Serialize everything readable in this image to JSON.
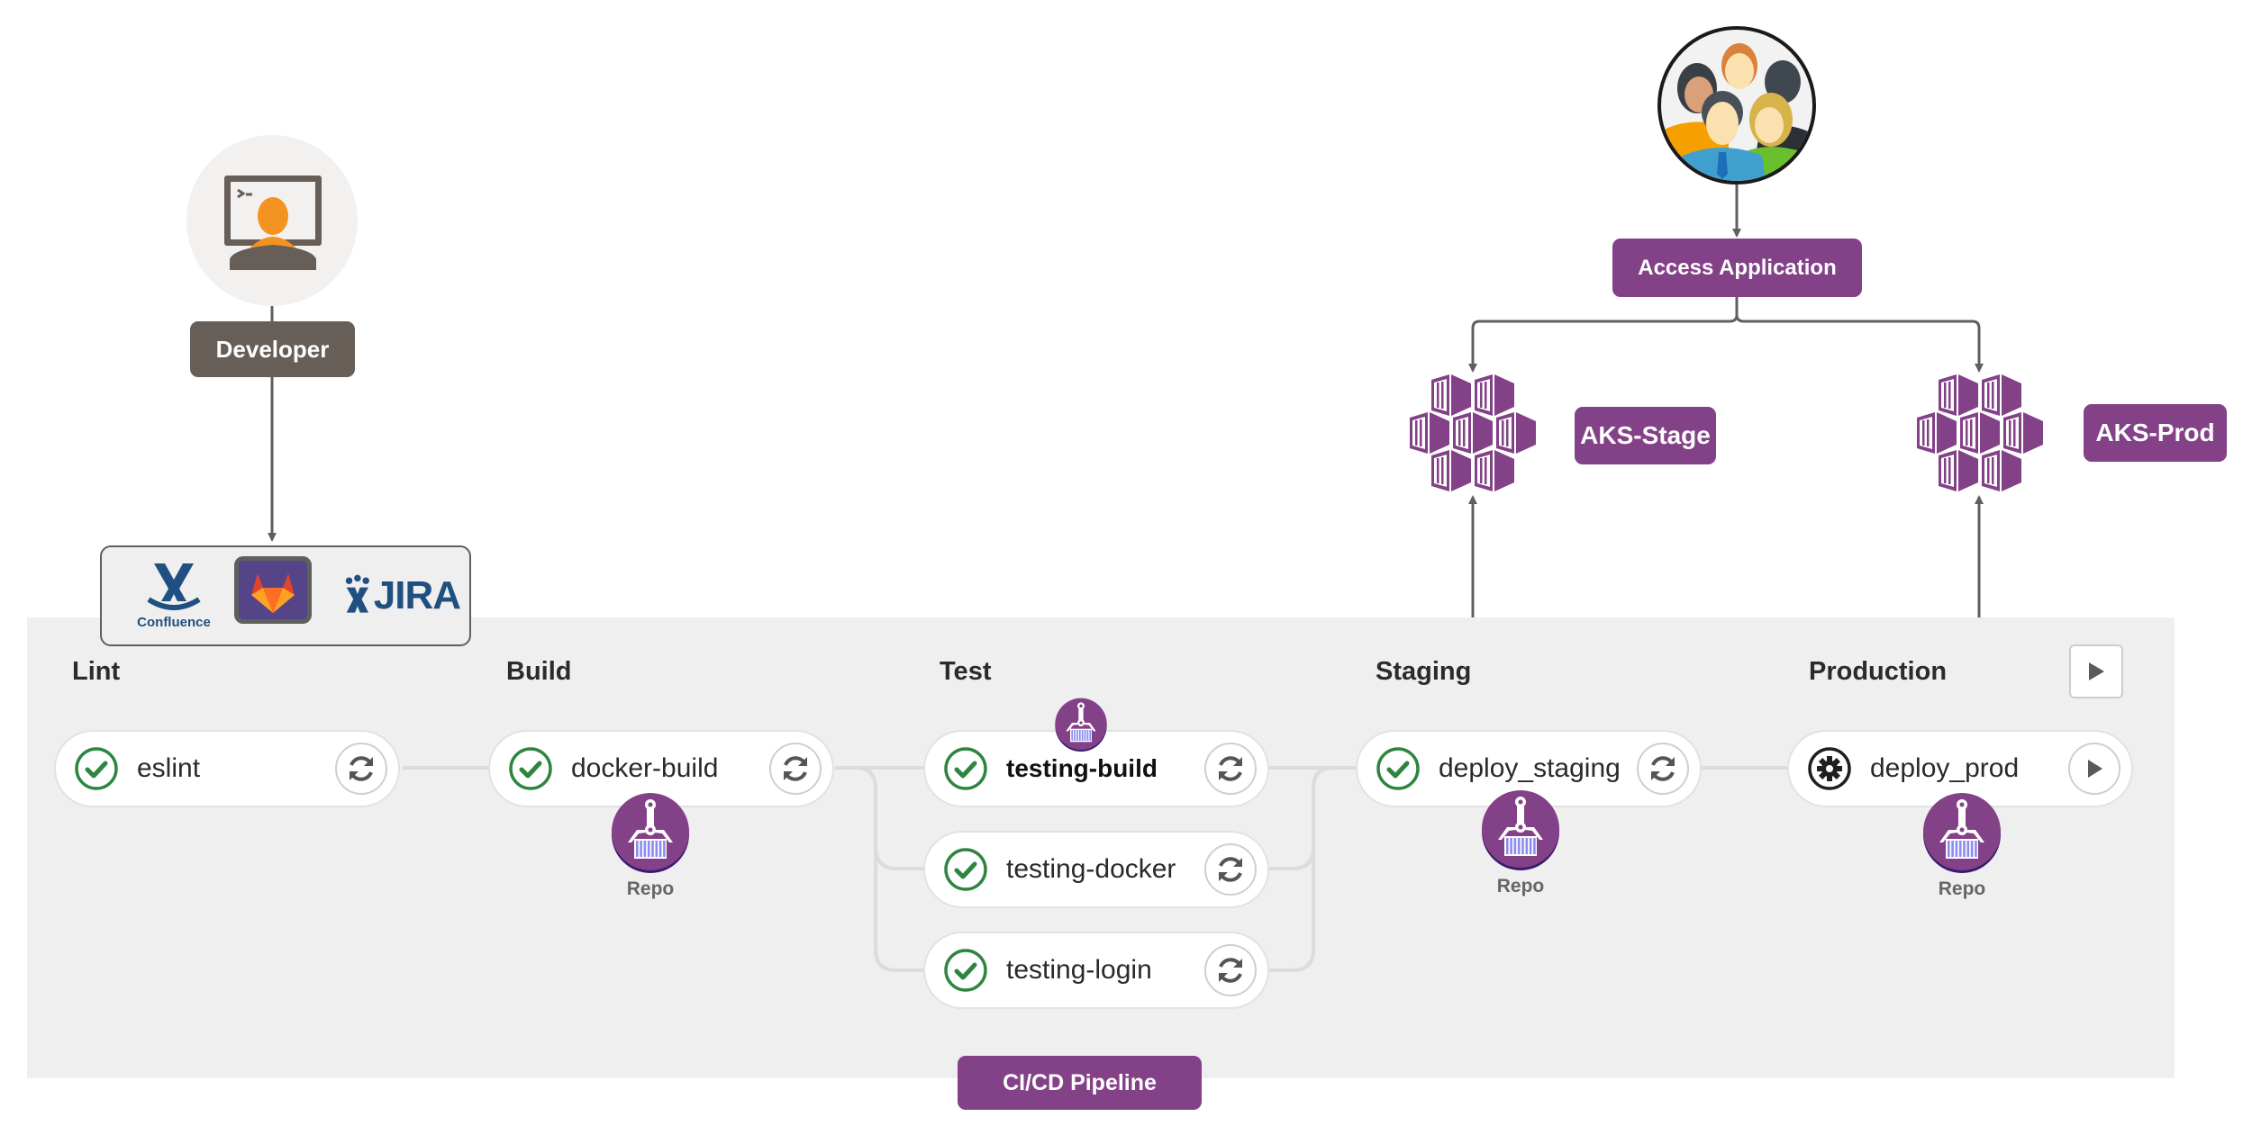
{
  "actors": {
    "developer": {
      "label": "Developer",
      "icon": "developer-terminal-icon"
    },
    "users": {
      "icon": "user-group-icon"
    }
  },
  "tools": [
    {
      "name": "Confluence",
      "icon": "confluence-icon",
      "label": "Confluence"
    },
    {
      "name": "GitLab",
      "icon": "gitlab-icon"
    },
    {
      "name": "JIRA",
      "icon": "jira-icon",
      "label": "JIRA"
    }
  ],
  "access": {
    "label": "Access Application"
  },
  "clusters": [
    {
      "label": "AKS-Stage",
      "icon": "kubernetes-service-icon"
    },
    {
      "label": "AKS-Prod",
      "icon": "kubernetes-service-icon"
    }
  ],
  "pipeline": {
    "label": "CI/CD Pipeline",
    "stages": [
      {
        "title": "Lint",
        "jobs": [
          {
            "name": "eslint",
            "status": "passed",
            "action": "retry"
          }
        ]
      },
      {
        "title": "Build",
        "jobs": [
          {
            "name": "docker-build",
            "status": "passed",
            "action": "retry"
          }
        ]
      },
      {
        "title": "Test",
        "jobs": [
          {
            "name": "testing-build",
            "status": "passed",
            "action": "retry"
          },
          {
            "name": "testing-docker",
            "status": "passed",
            "action": "retry"
          },
          {
            "name": "testing-login",
            "status": "passed",
            "action": "retry"
          }
        ]
      },
      {
        "title": "Staging",
        "jobs": [
          {
            "name": "deploy_staging",
            "status": "passed",
            "action": "retry"
          }
        ]
      },
      {
        "title": "Production",
        "jobs": [
          {
            "name": "deploy_prod",
            "status": "manual",
            "action": "play"
          }
        ]
      }
    ],
    "repo_label": "Repo"
  },
  "colors": {
    "purple": "#834187",
    "developer": "#675e57",
    "success": "#2e8540",
    "panel": "#efefef",
    "connector": "#5f5f5f"
  }
}
